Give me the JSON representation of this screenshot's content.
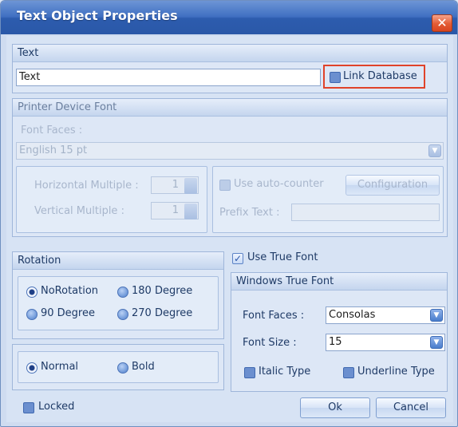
{
  "window": {
    "title": "Text Object Properties",
    "close_glyph": "✕"
  },
  "text_group": {
    "header": "Text",
    "text_value": "Text",
    "link_database_label": "Link Database",
    "link_database_checked": false
  },
  "printer_font_group": {
    "header": "Printer Device Font",
    "font_faces_label": "Font Faces :",
    "font_faces_value": "English 15 pt",
    "horizontal_multiple_label": "Horizontal Multiple :",
    "horizontal_multiple_value": "1",
    "vertical_multiple_label": "Vertical Multiple :",
    "vertical_multiple_value": "1",
    "use_auto_counter_label": "Use auto-counter",
    "configuration_label": "Configuration",
    "prefix_text_label": "Prefix Text :"
  },
  "rotation_group": {
    "header": "Rotation",
    "options": [
      "NoRotation",
      "180 Degree",
      "90 Degree",
      "270 Degree"
    ],
    "selected": "NoRotation"
  },
  "weight_group": {
    "options": [
      "Normal",
      "Bold"
    ],
    "selected": "Normal"
  },
  "true_font": {
    "use_true_font_label": "Use True Font",
    "use_true_font_checked": true,
    "header": "Windows True Font",
    "font_faces_label": "Font Faces :",
    "font_faces_value": "Consolas",
    "font_size_label": "Font Size :",
    "font_size_value": "15",
    "italic_label": "Italic Type",
    "underline_label": "Underline Type"
  },
  "footer": {
    "locked_label": "Locked",
    "ok_label": "Ok",
    "cancel_label": "Cancel"
  },
  "colors": {
    "title_bar": "#2d5cae",
    "highlight": "#e0432a",
    "close_button": "#e35b34"
  }
}
